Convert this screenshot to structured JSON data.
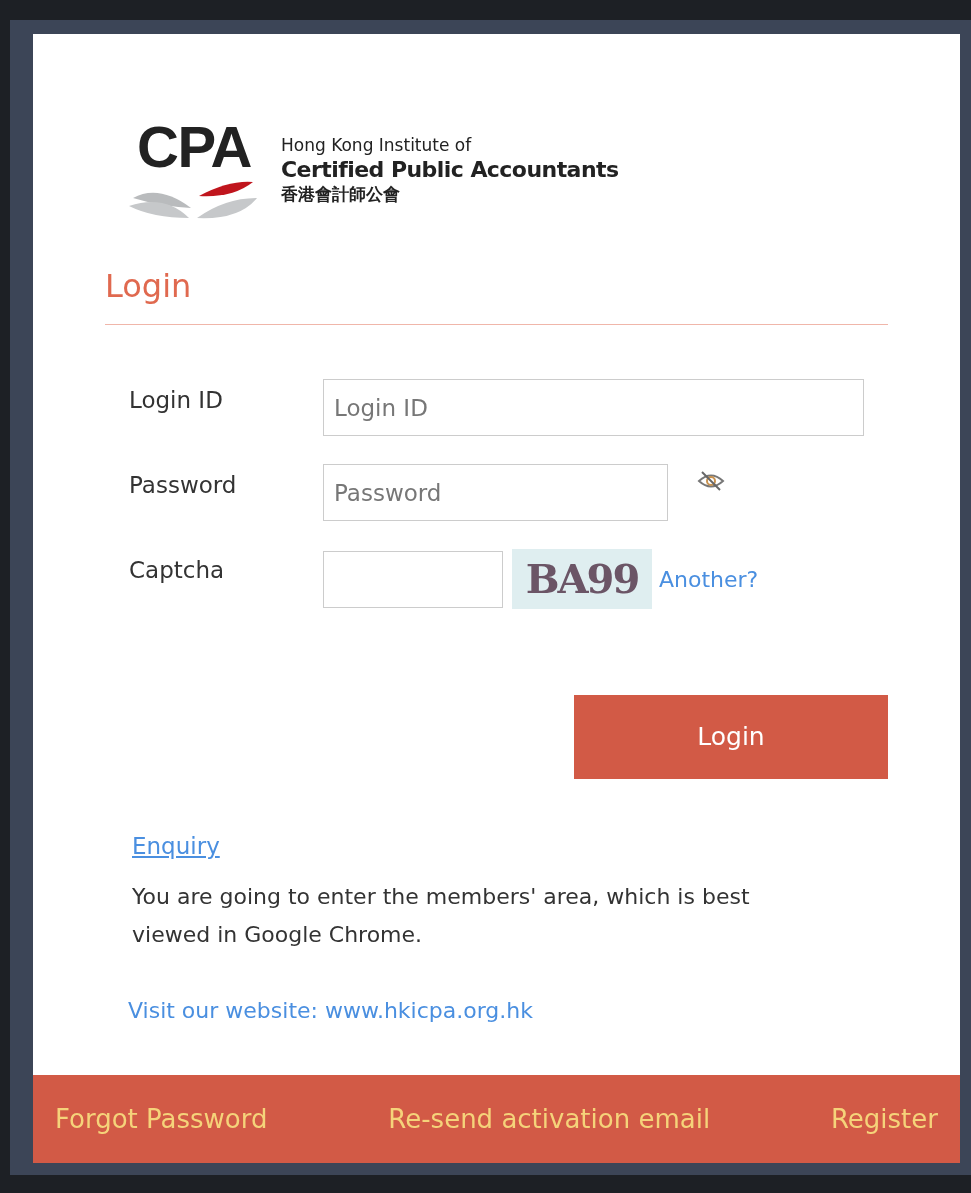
{
  "logo": {
    "mark": "CPA",
    "line_1": "Hong Kong Institute of",
    "line_2": "Certified Public Accountants",
    "line_3": "香港會計師公會"
  },
  "heading": "Login",
  "fields": [
    {
      "kind": "text",
      "label": "Login ID",
      "placeholder": "Login ID"
    },
    {
      "kind": "password",
      "label": "Password",
      "placeholder": "Password"
    },
    {
      "kind": "captcha",
      "label": "Captcha",
      "code": "BA99",
      "refresh": "Another?"
    }
  ],
  "login_button": "Login",
  "enquiry": "Enquiry",
  "notice": "You are going to enter the members' area, which is best viewed in Google Chrome.",
  "website": "Visit our website: www.hkicpa.org.hk",
  "footer_links": [
    "Forgot Password",
    "Re-send activation email",
    "Register"
  ]
}
